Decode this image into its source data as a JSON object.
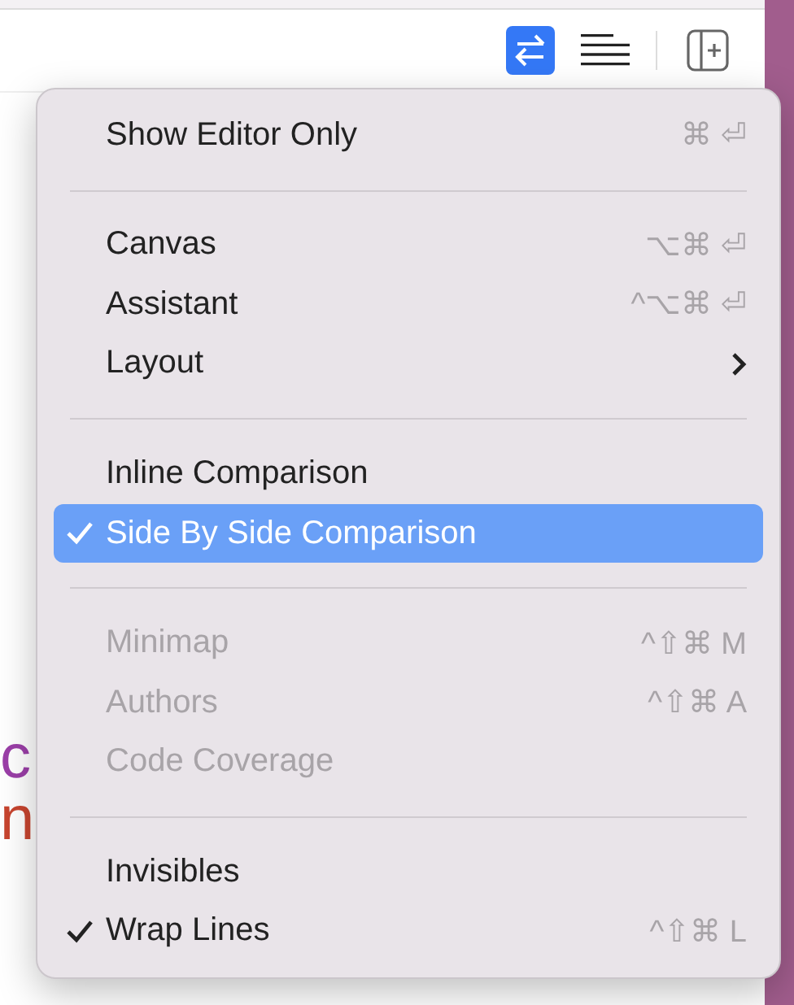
{
  "toolbar": {
    "buttons": [
      {
        "kind": "compare",
        "selected": true
      },
      {
        "kind": "lines",
        "selected": false
      },
      {
        "kind": "split",
        "selected": false
      }
    ]
  },
  "code_fragments": [
    {
      "text": "c",
      "color": "#9b3fa8"
    },
    {
      "text": "n",
      "color": "#c8452f"
    }
  ],
  "menu": {
    "sections": [
      [
        {
          "kind": "item",
          "label": "Show Editor Only",
          "shortcut": "⌘ ⏎",
          "checked": false,
          "selected": false,
          "disabled": false
        }
      ],
      [
        {
          "kind": "item",
          "label": "Canvas",
          "shortcut": "⌥⌘ ⏎",
          "checked": false,
          "selected": false,
          "disabled": false
        },
        {
          "kind": "item",
          "label": "Assistant",
          "shortcut": "^⌥⌘ ⏎",
          "checked": false,
          "selected": false,
          "disabled": false
        },
        {
          "kind": "submenu",
          "label": "Layout",
          "checked": false,
          "selected": false,
          "disabled": false
        }
      ],
      [
        {
          "kind": "item",
          "label": "Inline Comparison",
          "checked": false,
          "selected": false,
          "disabled": false
        },
        {
          "kind": "item",
          "label": "Side By Side Comparison",
          "checked": true,
          "selected": true,
          "disabled": false
        }
      ],
      [
        {
          "kind": "item",
          "label": "Minimap",
          "shortcut": "^⇧⌘ M",
          "checked": false,
          "selected": false,
          "disabled": true
        },
        {
          "kind": "item",
          "label": "Authors",
          "shortcut": "^⇧⌘ A",
          "checked": false,
          "selected": false,
          "disabled": true
        },
        {
          "kind": "item",
          "label": "Code Coverage",
          "checked": false,
          "selected": false,
          "disabled": true
        }
      ],
      [
        {
          "kind": "item",
          "label": "Invisibles",
          "checked": false,
          "selected": false,
          "disabled": false
        },
        {
          "kind": "item",
          "label": "Wrap Lines",
          "shortcut": "^⇧⌘ L",
          "checked": true,
          "selected": false,
          "disabled": false
        }
      ]
    ]
  }
}
